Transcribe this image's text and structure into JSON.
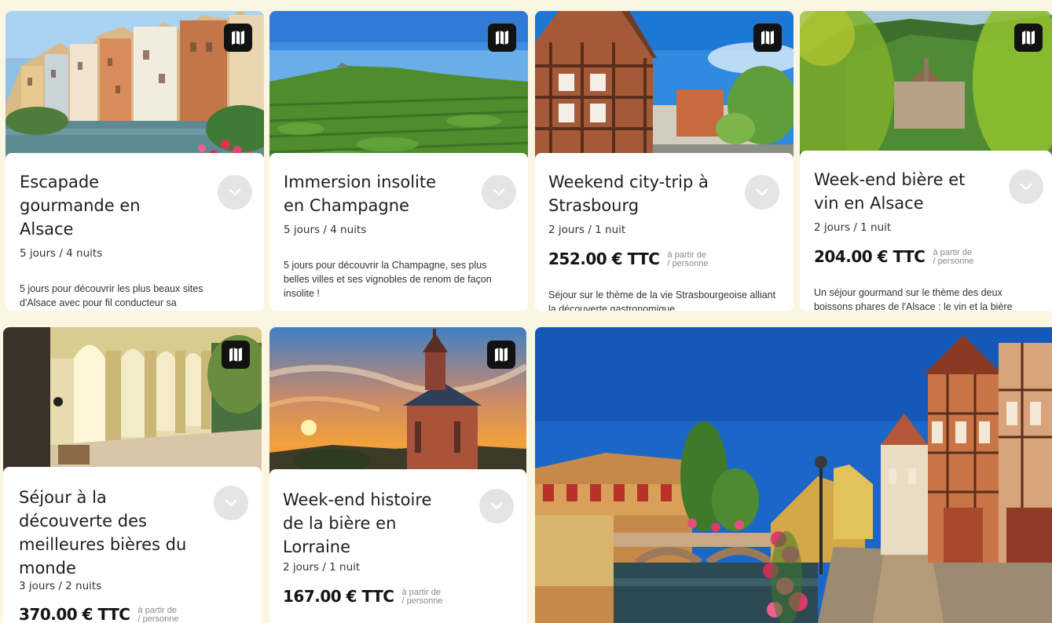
{
  "icons": {
    "map": "map-icon",
    "expand": "chevron-down-icon"
  },
  "colors": {
    "background": "#fbf6e2",
    "card": "#ffffff",
    "map_button": "#121212",
    "chevron_bg": "#e4e4e4"
  },
  "cards": [
    {
      "title_lines": [
        "Escapade",
        "gourmande en",
        "Alsace"
      ],
      "duration": "5 jours / 4 nuits",
      "description": "5 jours pour découvrir les plus beaux sites d'Alsace avec pour fil conducteur sa",
      "image": "colorful timbered houses along a canal"
    },
    {
      "title_lines": [
        "Immersion insolite",
        "en Champagne"
      ],
      "duration": "5 jours / 4 nuits",
      "description": "5 jours pour découvrir la Champagne, ses plus belles villes et ses vignobles de renom de façon insolite !",
      "image": "vineyard rows under blue sky"
    },
    {
      "title_lines": [
        "Weekend city-trip à",
        "Strasbourg"
      ],
      "duration": "2 jours / 1 nuit",
      "price": "252.00 € TTC",
      "price_note_1": "à partir de",
      "price_note_2": "/ personne",
      "description": "Séjour sur le thème de la vie Strasbourgeoise alliant la découverte gastronomique",
      "image": "half-timbered house in Strasbourg"
    },
    {
      "title_lines": [
        "Week-end bière et",
        "vin en Alsace"
      ],
      "duration": "2 jours / 1 nuit",
      "price": "204.00 € TTC",
      "price_note_1": "à partir de",
      "price_note_2": "/ personne",
      "description": "Un séjour gourmand sur le thème des deux boissons phares de l'Alsace : le vin et la bière",
      "image": "village among green hills through leaves"
    },
    {
      "title_lines": [
        "Séjour à la",
        "découverte des",
        "meilleures bières du",
        "monde"
      ],
      "duration": "3 jours / 2 nuits",
      "price": "370.00 € TTC",
      "price_note_1": "à partir de",
      "price_note_2": "/ personne",
      "image": "arched colonnade gallery"
    },
    {
      "title_lines": [
        "Week-end histoire",
        "de la bière en",
        "Lorraine"
      ],
      "duration": "2 jours / 1 nuit",
      "price": "167.00 € TTC",
      "price_note_1": "à partir de",
      "price_note_2": "/ personne",
      "image": "stone chapel at sunset"
    }
  ],
  "feature": {
    "image": "canal in Colmar with timbered houses and flowers"
  }
}
